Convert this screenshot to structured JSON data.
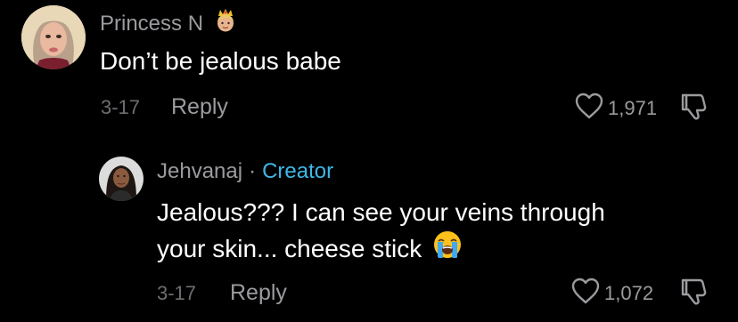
{
  "comments": [
    {
      "username": "Princess N",
      "username_emoji": "princess-icon",
      "text": "Don’t be jealous babe",
      "date": "3-17",
      "reply_label": "Reply",
      "likes": "1,971"
    }
  ],
  "replies": [
    {
      "username": "Jehvanaj",
      "separator": "·",
      "badge": "Creator",
      "text_line1": "Jealous??? I can see your veins through",
      "text_line2": "your skin... cheese stick",
      "text_emoji": "loudly-crying-face-icon",
      "date": "3-17",
      "reply_label": "Reply",
      "likes": "1,072"
    }
  ],
  "colors": {
    "background": "#000000",
    "primary_text": "#ffffff",
    "secondary_text": "#9b9b9f",
    "date_text": "#6e6e73",
    "creator_badge": "#3fb7e8"
  }
}
